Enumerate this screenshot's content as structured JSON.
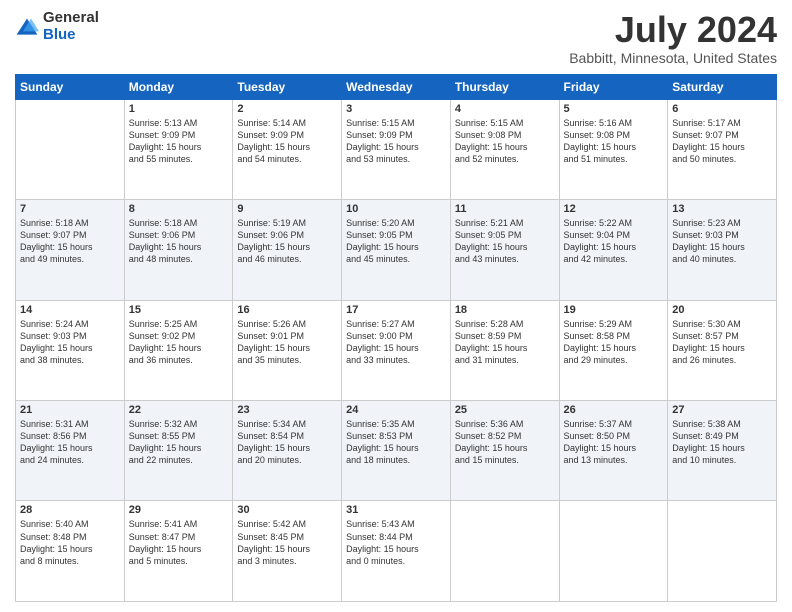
{
  "logo": {
    "general": "General",
    "blue": "Blue"
  },
  "header": {
    "title": "July 2024",
    "subtitle": "Babbitt, Minnesota, United States"
  },
  "days_of_week": [
    "Sunday",
    "Monday",
    "Tuesday",
    "Wednesday",
    "Thursday",
    "Friday",
    "Saturday"
  ],
  "weeks": [
    [
      {
        "day": "",
        "info": ""
      },
      {
        "day": "1",
        "info": "Sunrise: 5:13 AM\nSunset: 9:09 PM\nDaylight: 15 hours\nand 55 minutes."
      },
      {
        "day": "2",
        "info": "Sunrise: 5:14 AM\nSunset: 9:09 PM\nDaylight: 15 hours\nand 54 minutes."
      },
      {
        "day": "3",
        "info": "Sunrise: 5:15 AM\nSunset: 9:09 PM\nDaylight: 15 hours\nand 53 minutes."
      },
      {
        "day": "4",
        "info": "Sunrise: 5:15 AM\nSunset: 9:08 PM\nDaylight: 15 hours\nand 52 minutes."
      },
      {
        "day": "5",
        "info": "Sunrise: 5:16 AM\nSunset: 9:08 PM\nDaylight: 15 hours\nand 51 minutes."
      },
      {
        "day": "6",
        "info": "Sunrise: 5:17 AM\nSunset: 9:07 PM\nDaylight: 15 hours\nand 50 minutes."
      }
    ],
    [
      {
        "day": "7",
        "info": "Sunrise: 5:18 AM\nSunset: 9:07 PM\nDaylight: 15 hours\nand 49 minutes."
      },
      {
        "day": "8",
        "info": "Sunrise: 5:18 AM\nSunset: 9:06 PM\nDaylight: 15 hours\nand 48 minutes."
      },
      {
        "day": "9",
        "info": "Sunrise: 5:19 AM\nSunset: 9:06 PM\nDaylight: 15 hours\nand 46 minutes."
      },
      {
        "day": "10",
        "info": "Sunrise: 5:20 AM\nSunset: 9:05 PM\nDaylight: 15 hours\nand 45 minutes."
      },
      {
        "day": "11",
        "info": "Sunrise: 5:21 AM\nSunset: 9:05 PM\nDaylight: 15 hours\nand 43 minutes."
      },
      {
        "day": "12",
        "info": "Sunrise: 5:22 AM\nSunset: 9:04 PM\nDaylight: 15 hours\nand 42 minutes."
      },
      {
        "day": "13",
        "info": "Sunrise: 5:23 AM\nSunset: 9:03 PM\nDaylight: 15 hours\nand 40 minutes."
      }
    ],
    [
      {
        "day": "14",
        "info": "Sunrise: 5:24 AM\nSunset: 9:03 PM\nDaylight: 15 hours\nand 38 minutes."
      },
      {
        "day": "15",
        "info": "Sunrise: 5:25 AM\nSunset: 9:02 PM\nDaylight: 15 hours\nand 36 minutes."
      },
      {
        "day": "16",
        "info": "Sunrise: 5:26 AM\nSunset: 9:01 PM\nDaylight: 15 hours\nand 35 minutes."
      },
      {
        "day": "17",
        "info": "Sunrise: 5:27 AM\nSunset: 9:00 PM\nDaylight: 15 hours\nand 33 minutes."
      },
      {
        "day": "18",
        "info": "Sunrise: 5:28 AM\nSunset: 8:59 PM\nDaylight: 15 hours\nand 31 minutes."
      },
      {
        "day": "19",
        "info": "Sunrise: 5:29 AM\nSunset: 8:58 PM\nDaylight: 15 hours\nand 29 minutes."
      },
      {
        "day": "20",
        "info": "Sunrise: 5:30 AM\nSunset: 8:57 PM\nDaylight: 15 hours\nand 26 minutes."
      }
    ],
    [
      {
        "day": "21",
        "info": "Sunrise: 5:31 AM\nSunset: 8:56 PM\nDaylight: 15 hours\nand 24 minutes."
      },
      {
        "day": "22",
        "info": "Sunrise: 5:32 AM\nSunset: 8:55 PM\nDaylight: 15 hours\nand 22 minutes."
      },
      {
        "day": "23",
        "info": "Sunrise: 5:34 AM\nSunset: 8:54 PM\nDaylight: 15 hours\nand 20 minutes."
      },
      {
        "day": "24",
        "info": "Sunrise: 5:35 AM\nSunset: 8:53 PM\nDaylight: 15 hours\nand 18 minutes."
      },
      {
        "day": "25",
        "info": "Sunrise: 5:36 AM\nSunset: 8:52 PM\nDaylight: 15 hours\nand 15 minutes."
      },
      {
        "day": "26",
        "info": "Sunrise: 5:37 AM\nSunset: 8:50 PM\nDaylight: 15 hours\nand 13 minutes."
      },
      {
        "day": "27",
        "info": "Sunrise: 5:38 AM\nSunset: 8:49 PM\nDaylight: 15 hours\nand 10 minutes."
      }
    ],
    [
      {
        "day": "28",
        "info": "Sunrise: 5:40 AM\nSunset: 8:48 PM\nDaylight: 15 hours\nand 8 minutes."
      },
      {
        "day": "29",
        "info": "Sunrise: 5:41 AM\nSunset: 8:47 PM\nDaylight: 15 hours\nand 5 minutes."
      },
      {
        "day": "30",
        "info": "Sunrise: 5:42 AM\nSunset: 8:45 PM\nDaylight: 15 hours\nand 3 minutes."
      },
      {
        "day": "31",
        "info": "Sunrise: 5:43 AM\nSunset: 8:44 PM\nDaylight: 15 hours\nand 0 minutes."
      },
      {
        "day": "",
        "info": ""
      },
      {
        "day": "",
        "info": ""
      },
      {
        "day": "",
        "info": ""
      }
    ]
  ]
}
